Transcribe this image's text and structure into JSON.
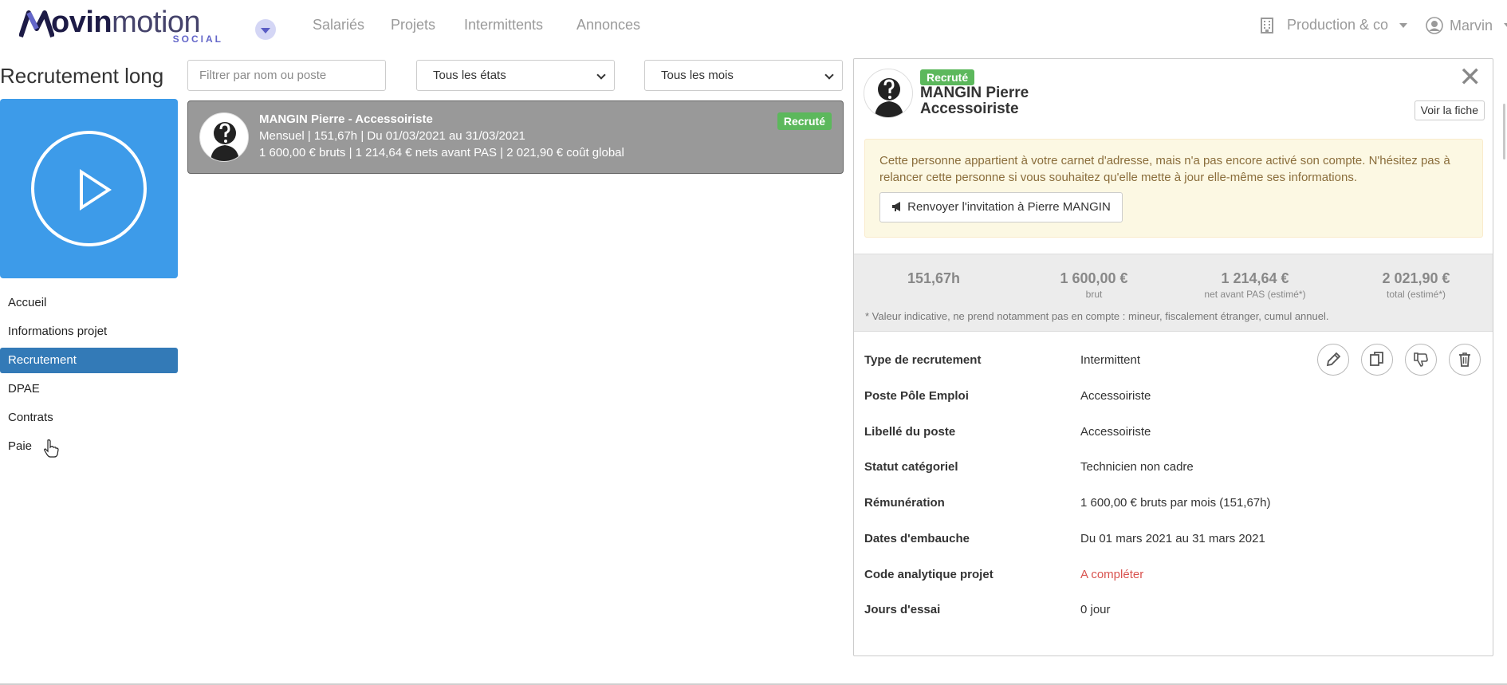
{
  "brand": {
    "logo_text": "movinmotion",
    "logo_sub": "SOCIAL"
  },
  "nav": {
    "links": [
      "Salariés",
      "Projets",
      "Intermittents",
      "Annonces"
    ],
    "company": "Production & co",
    "user": "Marvin"
  },
  "sidebar": {
    "title": "Recrutement long",
    "items": [
      "Accueil",
      "Informations projet",
      "Recrutement",
      "DPAE",
      "Contrats",
      "Paie"
    ],
    "active_item": "Recrutement"
  },
  "filters": {
    "search_placeholder": "Filtrer par nom ou poste",
    "state_select": "Tous les états",
    "month_select": "Tous les mois"
  },
  "recruitment_list": [
    {
      "title": "MANGIN Pierre - Accessoiriste",
      "line1": "Mensuel | 151,67h | Du 01/03/2021 au 31/03/2021",
      "line2": "1 600,00 € bruts | 1 214,64 € nets avant PAS | 2 021,90 € coût global",
      "status": "Recruté"
    }
  ],
  "detail": {
    "status": "Recruté",
    "name": "MANGIN Pierre",
    "role": "Accessoiriste",
    "close": "✕",
    "voir_fiche": "Voir la fiche",
    "alert_text": "Cette personne appartient à votre carnet d'adresse, mais n'a pas encore activé son compte. N'hésitez pas à relancer cette personne si vous souhaitez qu'elle mette à jour elle-même ses informations.",
    "alert_button": "Renvoyer l'invitation à Pierre MANGIN",
    "stats": [
      {
        "value": "151,67h",
        "label": ""
      },
      {
        "value": "1 600,00 €",
        "label": "brut"
      },
      {
        "value": "1 214,64 €",
        "label": "net avant PAS (estimé*)"
      },
      {
        "value": "2 021,90 €",
        "label": "total (estimé*)"
      }
    ],
    "stats_note": "* Valeur indicative, ne prend notamment pas en compte : mineur, fiscalement étranger, cumul annuel.",
    "rows": [
      {
        "label": "Type de recrutement",
        "value": "Intermittent"
      },
      {
        "label": "Poste Pôle Emploi",
        "value": "Accessoiriste"
      },
      {
        "label": "Libellé du poste",
        "value": "Accessoiriste"
      },
      {
        "label": "Statut catégoriel",
        "value": "Technicien non cadre"
      },
      {
        "label": "Rémunération",
        "value": "1 600,00 € bruts par mois (151,67h)"
      },
      {
        "label": "Dates d'embauche",
        "value": "Du 01 mars 2021 au 31 mars 2021"
      },
      {
        "label": "Code analytique projet",
        "value": "A compléter"
      },
      {
        "label": "Jours d'essai",
        "value": "0 jour"
      }
    ]
  },
  "colors": {
    "accent": "#337ab7",
    "video_tile": "#3d9be9",
    "success": "#5cb85c",
    "warning_bg": "#fcf8e3",
    "danger_text": "#d9534f"
  }
}
